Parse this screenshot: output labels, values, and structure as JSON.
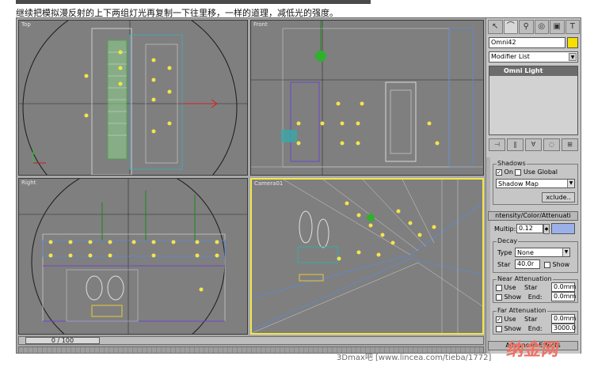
{
  "caption": "继续把模拟漫反射的上下两组灯光再复制一下往里移，一样的道理，减低光的强度。",
  "viewports": {
    "top": "Top",
    "front": "Front",
    "left": "Right",
    "camera": "Camera01"
  },
  "timeline": {
    "slider": "0 / 100"
  },
  "panel": {
    "object_name": "Omni42",
    "modifier_list": "Modifier List",
    "stack_item": "Omni Light",
    "shadows": {
      "title": "Shadows",
      "on_label": "On",
      "on_checked": true,
      "use_global_label": "Use Global",
      "type": "Shadow Map",
      "exclude": "xclude.."
    },
    "intensity": {
      "title": "ntensity/Color/Attenuati",
      "multiplier_label": "Multip:",
      "multiplier_value": "0.12",
      "decay_title": "Decay",
      "type_label": "Type",
      "type_value": "None",
      "start_label": "Star",
      "start_value": "40.0r",
      "show_label": "Show"
    },
    "near_atten": {
      "title": "Near Attenuation",
      "use_label": "Use",
      "start_label": "Star",
      "start_value": "0.0mm",
      "show_label": "Show",
      "end_label": "End:",
      "end_value": "0.0mm"
    },
    "far_atten": {
      "title": "Far Attenuation",
      "use_label": "Use",
      "use_checked": true,
      "start_label": "Star",
      "start_value": "0.0mm",
      "show_label": "Show",
      "end_label": "End:",
      "end_value": "3000.0"
    },
    "advanced": "Advanced Effects"
  },
  "watermark": "3Dmax吧 [www.lincea.com/tieba/1772]",
  "logo": "纳金网",
  "colors": {
    "accent_yellow": "#f3e64a",
    "light_color": "#9bb0e8",
    "swatch": "#f7df00"
  }
}
